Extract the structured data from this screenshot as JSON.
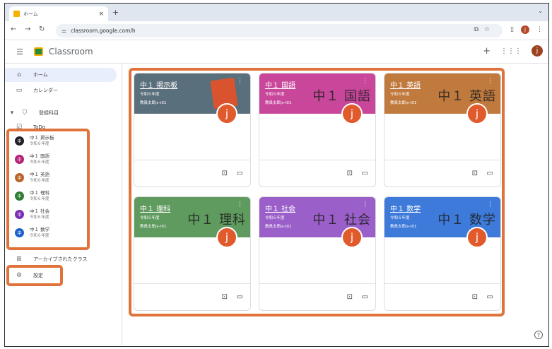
{
  "browser": {
    "tab_title": "ホーム",
    "tab_close": "×",
    "new_tab": "+",
    "url": "classroom.google.com/h"
  },
  "app": {
    "name": "Classroom",
    "avatar_letter": "j"
  },
  "sidebar": {
    "home": "ホーム",
    "calendar": "カレンダー",
    "enrolled": "登録科目",
    "todo": "ToDo",
    "archived": "アーカイブされたクラス",
    "settings": "設定",
    "classes": [
      {
        "name": "中１ 掲示板",
        "sub": "令和６年度",
        "dot": "中",
        "color": "#202124"
      },
      {
        "name": "中１ 国語",
        "sub": "令和６年度",
        "dot": "中",
        "color": "#b5237a"
      },
      {
        "name": "中１ 英語",
        "sub": "令和６年度",
        "dot": "中",
        "color": "#b9642a"
      },
      {
        "name": "中１ 理科",
        "sub": "令和６年度",
        "dot": "中",
        "color": "#2e7d32"
      },
      {
        "name": "中１ 社会",
        "sub": "令和６年度",
        "dot": "中",
        "color": "#7b2fb5"
      },
      {
        "name": "中１ 数学",
        "sub": "令和６年度",
        "dot": "中",
        "color": "#1f62c9"
      }
    ]
  },
  "cards": [
    {
      "title": "中１ 掲示板",
      "year": "令和６年度",
      "teacher": "教員太郎js-t01",
      "big": "",
      "color": "#5a6f7c",
      "avatar": "j"
    },
    {
      "title": "中１ 国語",
      "year": "令和６年度",
      "teacher": "教員太郎js-t01",
      "big": "中１ 国語",
      "color": "#c8479a",
      "avatar": "j"
    },
    {
      "title": "中１ 英語",
      "year": "令和６年度",
      "teacher": "教員太郎js-t01",
      "big": "中１ 英語",
      "color": "#c17a3e",
      "avatar": "j"
    },
    {
      "title": "中１ 理科",
      "year": "令和６年度",
      "teacher": "教員太郎js-t01",
      "big": "中１ 理科",
      "color": "#5f9a5e",
      "avatar": "j"
    },
    {
      "title": "中１ 社会",
      "year": "令和６年度",
      "teacher": "教員太郎js-t01",
      "big": "中１ 社会",
      "color": "#9a5fc9",
      "avatar": "j"
    },
    {
      "title": "中１ 数学",
      "year": "令和６年度",
      "teacher": "教員太郎js-t01",
      "big": "中１ 数学",
      "color": "#3d7ad9",
      "avatar": "j"
    }
  ]
}
